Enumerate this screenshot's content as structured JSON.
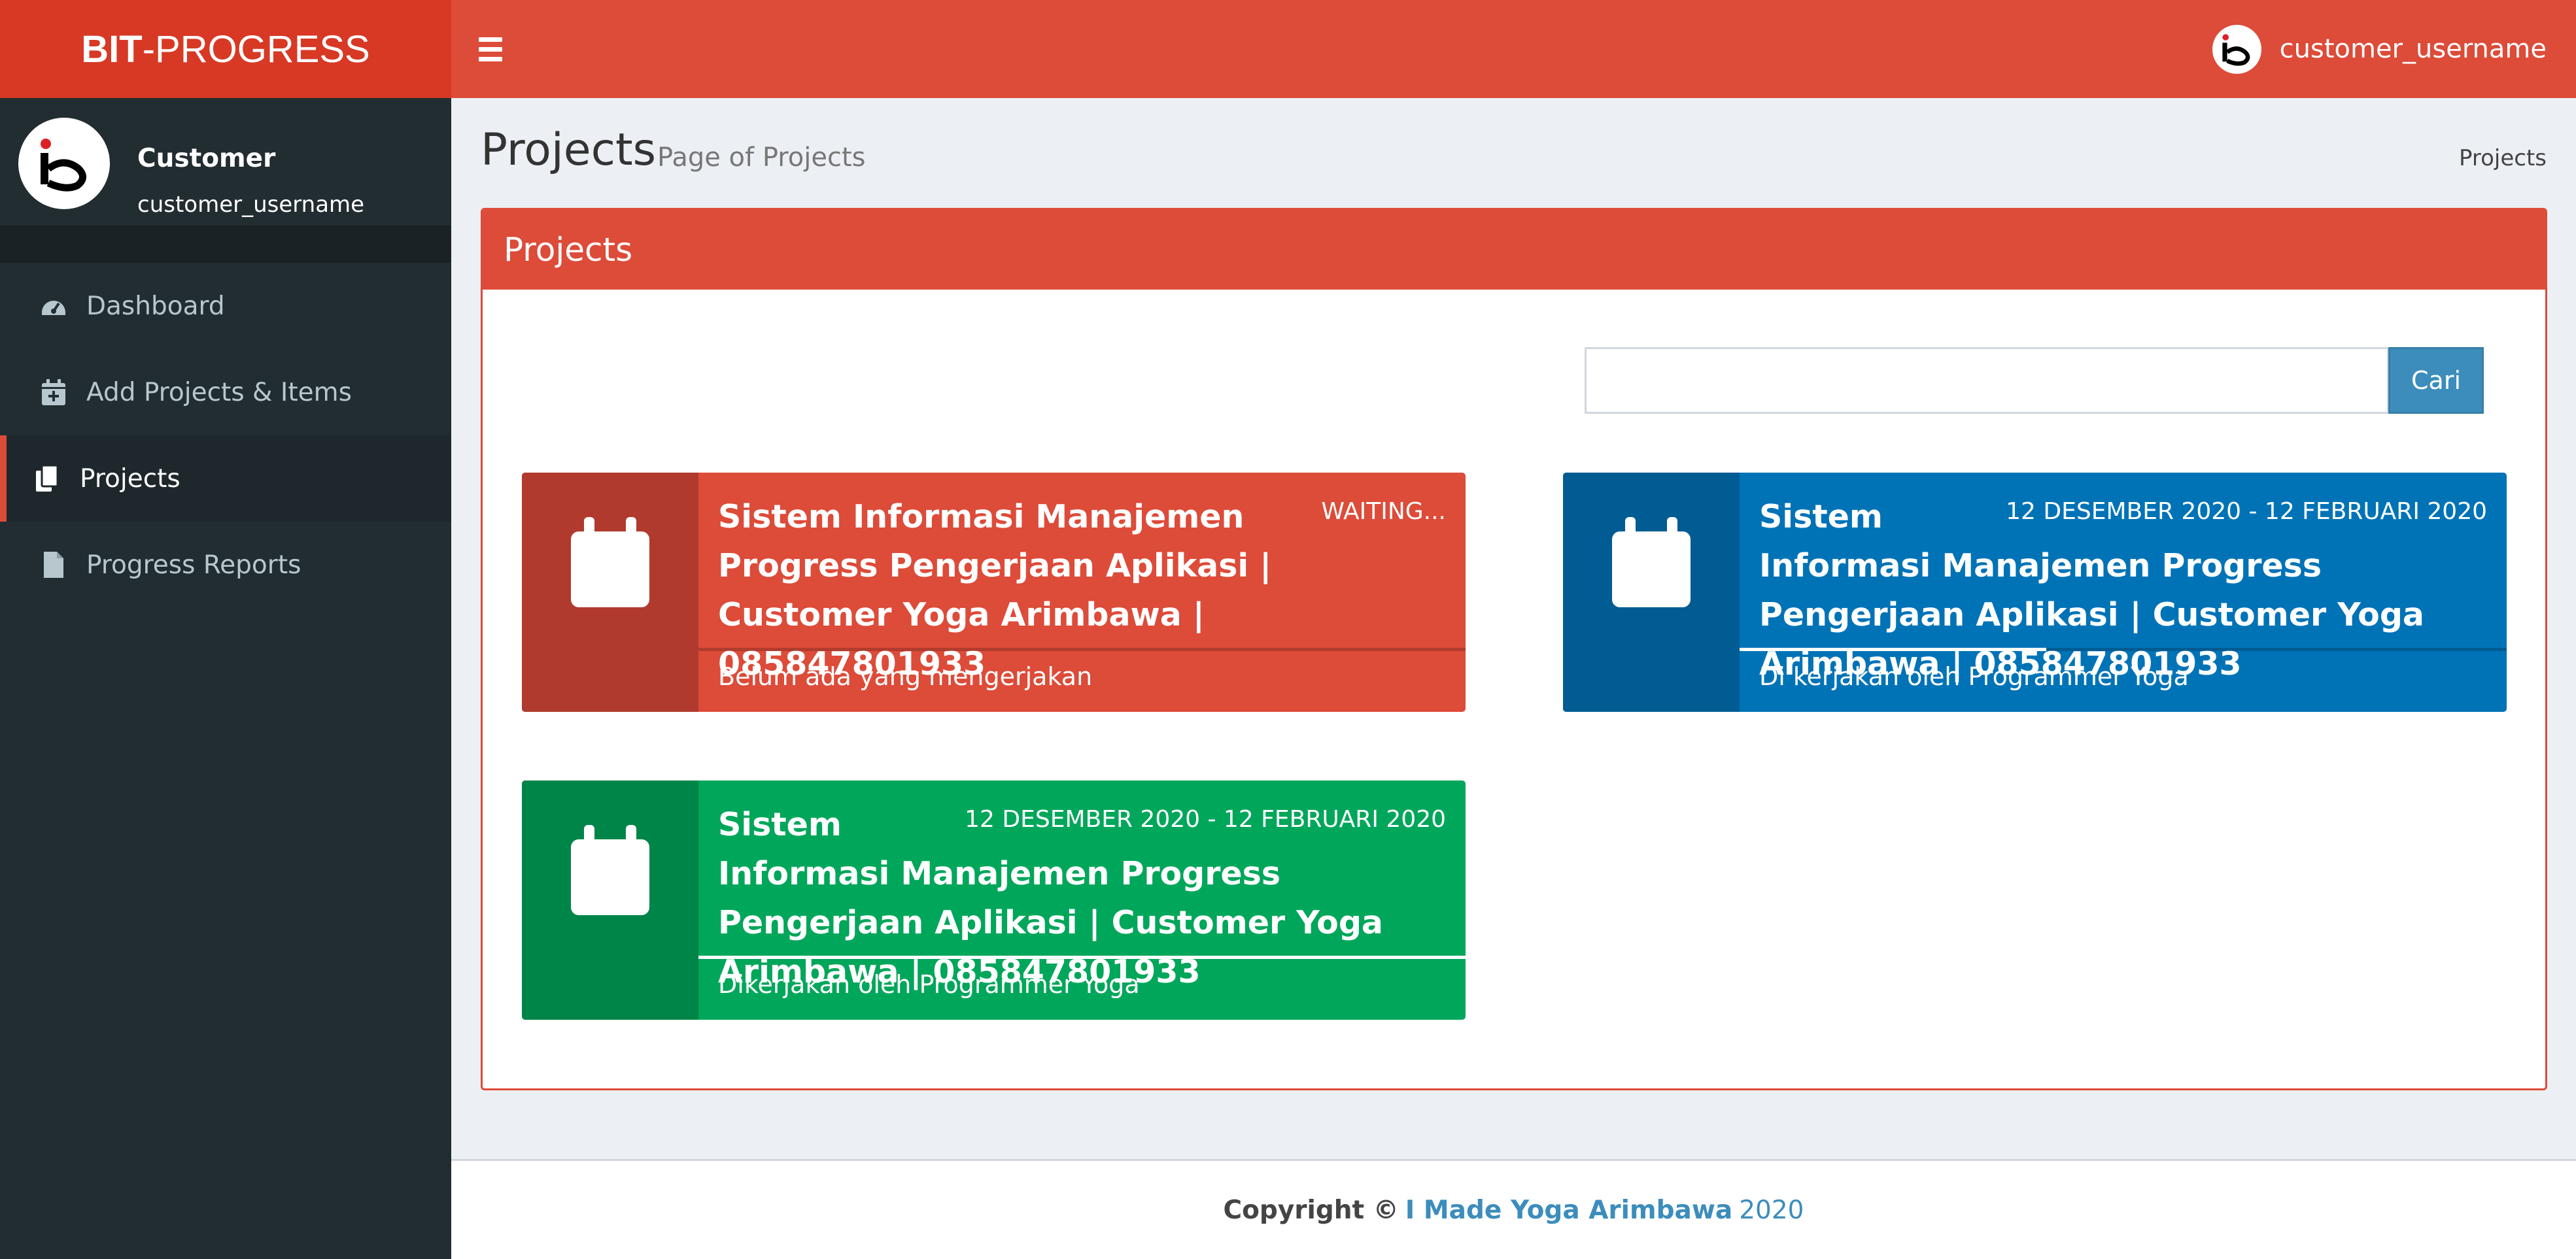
{
  "brand": {
    "bold": "BIT",
    "rest": "-PROGRESS",
    "color": "#d73925"
  },
  "navbar": {
    "toggle_icon": "hamburger-icon",
    "username": "customer_username",
    "color": "#dd4b39"
  },
  "user_panel": {
    "name": "Customer",
    "username": "customer_username"
  },
  "sidebar": {
    "items": [
      {
        "label": "Dashboard",
        "icon": "dashboard-icon",
        "active": false
      },
      {
        "label": "Add Projects & Items",
        "icon": "calendar-plus-icon",
        "active": false
      },
      {
        "label": "Projects",
        "icon": "copy-icon",
        "active": true
      },
      {
        "label": "Progress Reports",
        "icon": "file-icon",
        "active": false
      }
    ]
  },
  "page": {
    "title": "Projects",
    "subtitle": "Page of Projects",
    "breadcrumb": "Projects"
  },
  "box": {
    "title": "Projects"
  },
  "search": {
    "value": "",
    "placeholder": "",
    "button_label": "Cari"
  },
  "projects": [
    {
      "title": "Sistem Informasi Manajemen Progress Pengerjaan Aplikasi | Customer Yoga Arimbawa | 085847801933",
      "date": "WAITING...",
      "footer": "Belum ada yang mengerjakan",
      "progress": 0,
      "color": "#dd4b39"
    },
    {
      "title": "Sistem Informasi Manajemen Progress Pengerjaan Aplikasi | Customer Yoga Arimbawa | 085847801933",
      "date": "12 DESEMBER 2020 - 12 FEBRUARI 2020",
      "footer": "Di kerjakan oleh Programmer Yoga",
      "progress": 0.4,
      "color": "#0073b7"
    },
    {
      "title": "Sistem Informasi Manajemen Progress Pengerjaan Aplikasi | Customer Yoga Arimbawa | 085847801933",
      "date": "12 DESEMBER 2020 - 12 FEBRUARI 2020",
      "footer": "Dikerjakan oleh Programmer Yoga",
      "progress": 1,
      "color": "#00a65a"
    }
  ],
  "footer": {
    "copyright": "Copyright ©",
    "author": "I Made Yoga Arimbawa",
    "year": "2020"
  }
}
